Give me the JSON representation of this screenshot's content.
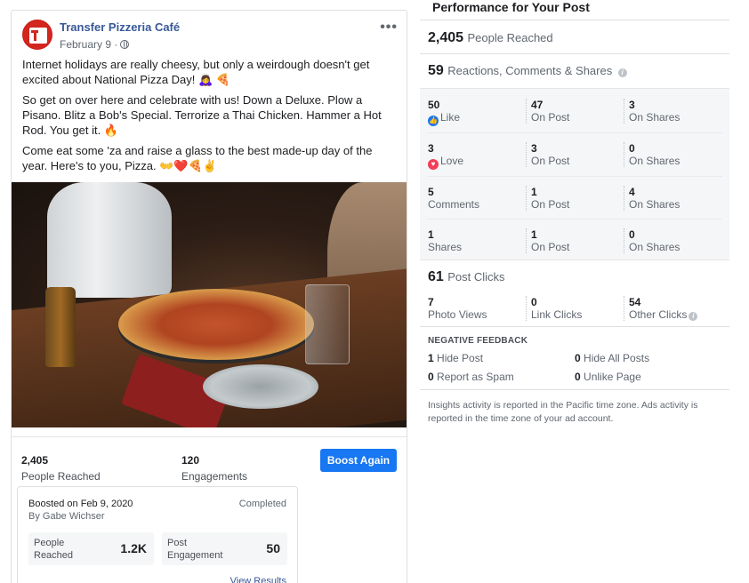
{
  "post": {
    "page_name": "Transfer Pizzeria Café",
    "date": "February 9 ·",
    "paragraphs": [
      "Internet holidays are really cheesy, but only a weirdough doesn't get excited about National Pizza Day! 🙇‍♀️ 🍕",
      "So get on over here and celebrate with us! Down a Deluxe. Plow a Pisano. Blitz a Bob's Special. Terrorize a Thai Chicken. Hammer a Hot Rod. You get it. 🔥",
      "Come eat some 'za and raise a glass to the best made-up day of the year. Here's to you, Pizza. 👐❤️🍕✌️"
    ],
    "stats": {
      "reached_value": "2,405",
      "reached_label": "People Reached",
      "engagements_value": "120",
      "engagements_label": "Engagements",
      "boost_button": "Boost Again"
    },
    "boost": {
      "title": "Boosted on Feb 9, 2020",
      "by": "By Gabe Wichser",
      "status": "Completed",
      "reached_label": "People Reached",
      "reached_value": "1.2K",
      "engagement_label": "Post Engagement",
      "engagement_value": "50",
      "view_results": "View Results"
    }
  },
  "performance": {
    "title": "Performance for Your Post",
    "people_reached": {
      "value": "2,405",
      "label": "People Reached"
    },
    "reactions": {
      "value": "59",
      "label": "Reactions, Comments & Shares"
    },
    "rows": [
      {
        "total": "50",
        "type": "Like",
        "on_post": "47",
        "on_post_label": "On Post",
        "on_shares": "3",
        "on_shares_label": "On Shares"
      },
      {
        "total": "3",
        "type": "Love",
        "on_post": "3",
        "on_post_label": "On Post",
        "on_shares": "0",
        "on_shares_label": "On Shares"
      },
      {
        "total": "5",
        "type": "Comments",
        "on_post": "1",
        "on_post_label": "On Post",
        "on_shares": "4",
        "on_shares_label": "On Shares"
      },
      {
        "total": "1",
        "type": "Shares",
        "on_post": "1",
        "on_post_label": "On Post",
        "on_shares": "0",
        "on_shares_label": "On Shares"
      }
    ],
    "post_clicks": {
      "value": "61",
      "label": "Post Clicks"
    },
    "clicks": [
      {
        "value": "7",
        "label": "Photo Views"
      },
      {
        "value": "0",
        "label": "Link Clicks"
      },
      {
        "value": "54",
        "label": "Other Clicks"
      }
    ],
    "negative_feedback": {
      "title": "NEGATIVE FEEDBACK",
      "items": [
        {
          "value": "1",
          "label": "Hide Post"
        },
        {
          "value": "0",
          "label": "Hide All Posts"
        },
        {
          "value": "0",
          "label": "Report as Spam"
        },
        {
          "value": "0",
          "label": "Unlike Page"
        }
      ]
    },
    "footnote": "Insights activity is reported in the Pacific time zone. Ads activity is reported in the time zone of your ad account."
  },
  "icons": {
    "avatar": "page-logo-icon",
    "privacy": "globe-icon",
    "more": "more-options-icon",
    "like": "like-reaction-icon",
    "love": "love-reaction-icon",
    "info": "info-icon"
  },
  "colors": {
    "accent": "#1877f2",
    "link": "#385898",
    "love": "#f33e58"
  }
}
